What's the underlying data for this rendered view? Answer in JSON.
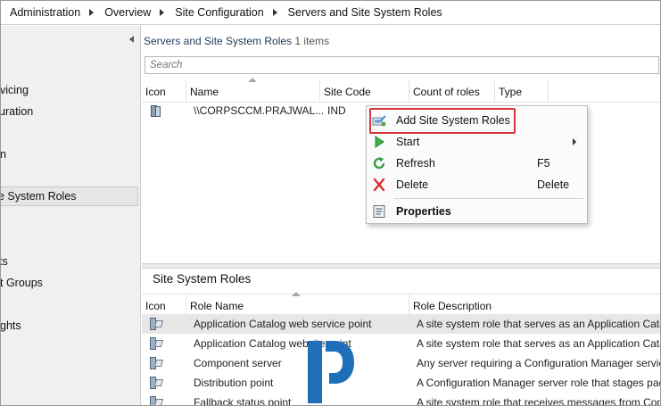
{
  "breadcrumb": [
    "Administration",
    "Overview",
    "Site Configuration",
    "Servers and Site System Roles"
  ],
  "leftnav": {
    "items": [
      "vicing",
      "uration",
      "n",
      "e System Roles",
      "ts",
      "t Groups",
      "ghts"
    ],
    "selected_index": 3
  },
  "pane": {
    "title": "Servers and Site System Roles",
    "count": "1 items",
    "search_placeholder": "Search"
  },
  "servers_table": {
    "columns": [
      "Icon",
      "Name",
      "Site Code",
      "Count of roles",
      "Type"
    ],
    "rows": [
      {
        "name": "\\\\CORPSCCM.PRAJWAL...",
        "site_code": "IND",
        "count_of_roles": "",
        "type": ""
      }
    ]
  },
  "context_menu": {
    "items": [
      {
        "label": "Add Site System Roles",
        "shortcut": "",
        "icon": "add-role-icon",
        "highlighted": true
      },
      {
        "label": "Start",
        "shortcut": "",
        "icon": "start-icon",
        "submenu": true
      },
      {
        "label": "Refresh",
        "shortcut": "F5",
        "icon": "refresh-icon"
      },
      {
        "label": "Delete",
        "shortcut": "Delete",
        "icon": "delete-icon"
      },
      {
        "label": "Properties",
        "shortcut": "",
        "icon": "properties-icon",
        "bold": true
      }
    ],
    "highlight_color": "#d9363b"
  },
  "roles_pane": {
    "title": "Site System Roles",
    "columns": [
      "Icon",
      "Role Name",
      "Role Description"
    ],
    "rows": [
      {
        "name": "Application Catalog web service point",
        "description": "A site system role that serves as an Application Cata"
      },
      {
        "name": "Application Catalog website point",
        "description": "A site system role that serves as an Application Cata"
      },
      {
        "name": "Component server",
        "description": "Any server requiring a Configuration Manager servic"
      },
      {
        "name": "Distribution point",
        "description": "A Configuration Manager server role that stages pac"
      },
      {
        "name": "Fallback status point",
        "description": "A site system role that receives messages from Confi"
      }
    ],
    "selected_index": 0
  },
  "watermark": {
    "icon": "prajwal-logo-icon",
    "color": "#1e6fb8"
  }
}
